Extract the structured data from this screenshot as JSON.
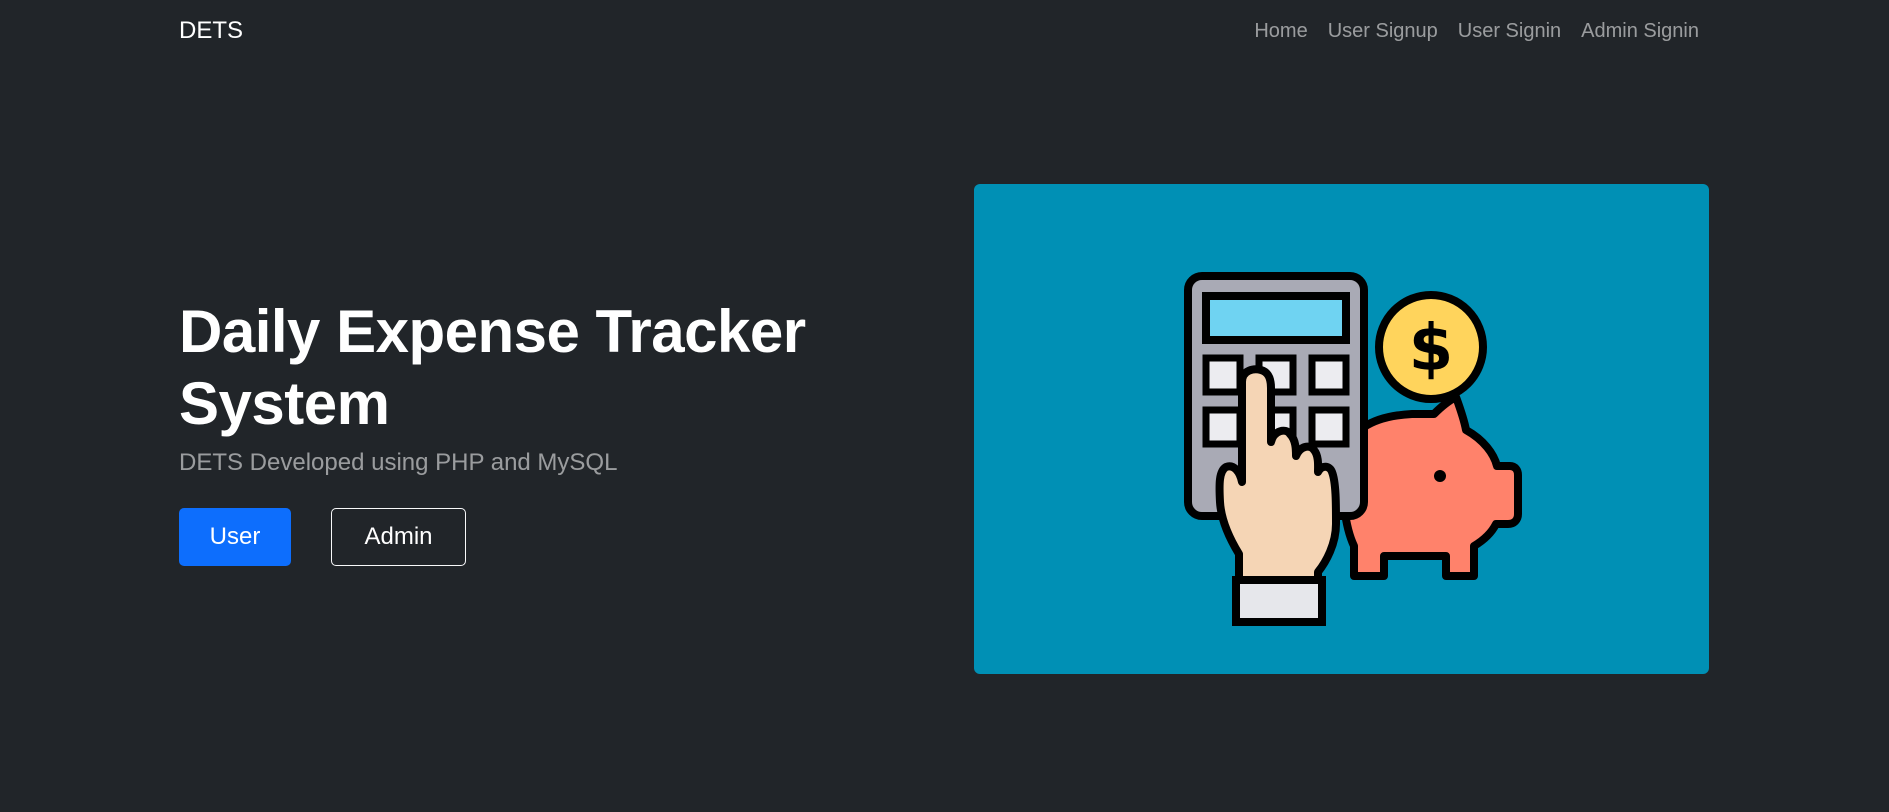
{
  "navbar": {
    "brand": "DETS",
    "links": [
      "Home",
      "User Signup",
      "User Signin",
      "Admin Signin"
    ]
  },
  "hero": {
    "title": "Daily Expense Tracker System",
    "subtitle": "DETS Developed using PHP and MySQL",
    "buttons": {
      "user": "User",
      "admin": "Admin"
    },
    "image": {
      "icon": "expense-calculator-piggy-bank-icon",
      "background": "#0090b5",
      "coin_symbol": "$"
    }
  },
  "colors": {
    "page_bg": "#212529",
    "primary": "#0d6efd"
  }
}
